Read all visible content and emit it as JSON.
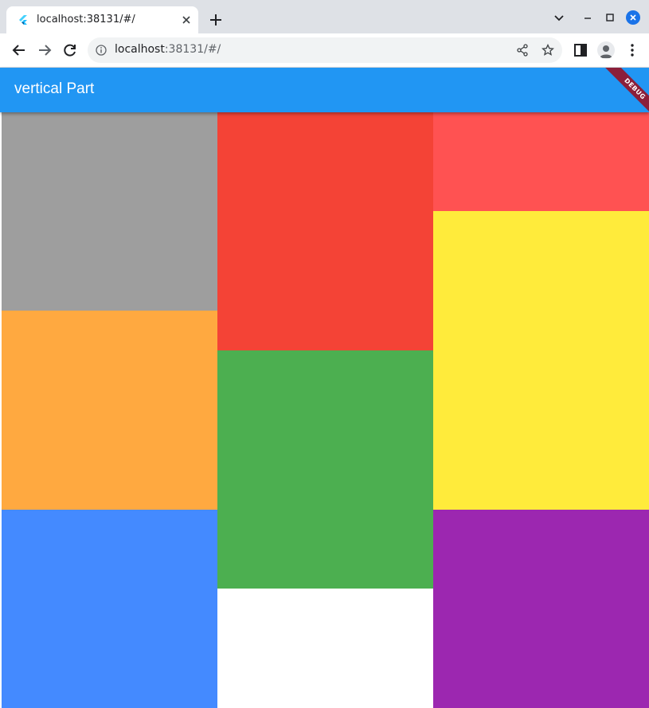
{
  "browser": {
    "tab": {
      "title": "localhost:38131/#/",
      "favicon": "flutter-icon"
    },
    "address_bar": {
      "host": "localhost",
      "rest": ":38131/#/"
    },
    "icons": [
      "back-arrow-icon",
      "forward-arrow-icon",
      "reload-icon",
      "info-icon",
      "share-icon",
      "star-icon",
      "side-panel-icon",
      "profile-icon",
      "kebab-menu-icon",
      "tab-close-icon",
      "new-tab-icon",
      "chevron-down-icon",
      "minimize-icon",
      "maximize-icon",
      "window-close-icon"
    ]
  },
  "app": {
    "title": "vertical Part",
    "debug_banner": "DEBUG",
    "colors": {
      "appbar": "#2196f3",
      "debug": "#8b1f3a"
    }
  },
  "tiles": {
    "column1": [
      "#9e9e9e",
      "#ffa940",
      "#448aff"
    ],
    "column2": [
      "#f44336",
      "#4caf50",
      "#ffffff"
    ],
    "column3": [
      "#ff5252",
      "#ffeb3b",
      "#9c27b0"
    ]
  }
}
